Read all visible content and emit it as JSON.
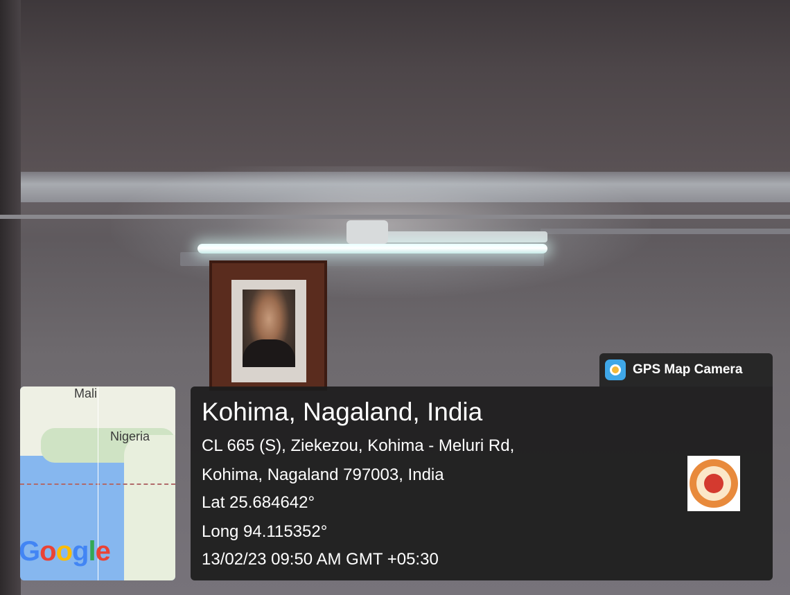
{
  "map": {
    "labels": {
      "mali": "Mali",
      "nigeria": "Nigeria"
    },
    "attribution": {
      "g": "G",
      "o1": "o",
      "o2": "o",
      "g2": "g",
      "l": "l",
      "e": "e"
    }
  },
  "app": {
    "name": "GPS Map Camera",
    "icon": "camera-pin-icon"
  },
  "location": {
    "title": "Kohima, Nagaland, India",
    "address_line1": "CL 665 (S), Ziekezou, Kohima - Meluri Rd,",
    "address_line2": "Kohima, Nagaland 797003, India",
    "latitude": "Lat 25.684642°",
    "longitude": "Long 94.115352°",
    "datetime": "13/02/23 09:50 AM GMT +05:30"
  },
  "colors": {
    "panel": "#1c1c1c",
    "text": "#ffffff"
  }
}
